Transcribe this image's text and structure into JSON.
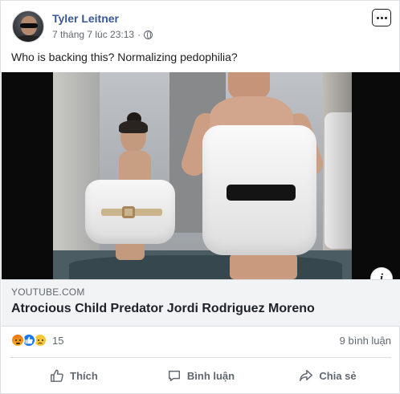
{
  "post": {
    "author": "Tyler Leitner",
    "timestamp": "7 tháng 7 lúc 23:13",
    "separator": "·",
    "caption": "Who is backing this? Normalizing pedophilia?",
    "more_icon": "ellipsis-icon",
    "privacy_icon": "globe-icon"
  },
  "link": {
    "domain": "YOUTUBE.COM",
    "title": "Atrocious Child Predator Jordi Rodriguez Moreno",
    "info_glyph": "i"
  },
  "stats": {
    "reactions": [
      "angry",
      "like",
      "sad"
    ],
    "reaction_count": "15",
    "comment_count": "9 bình luận"
  },
  "actions": {
    "like_label": "Thích",
    "comment_label": "Bình luận",
    "share_label": "Chia sẻ"
  },
  "colors": {
    "author": "#385898",
    "secondary_text": "#606770",
    "link_bg": "#f2f3f5",
    "like_blue": "#1877f2"
  }
}
